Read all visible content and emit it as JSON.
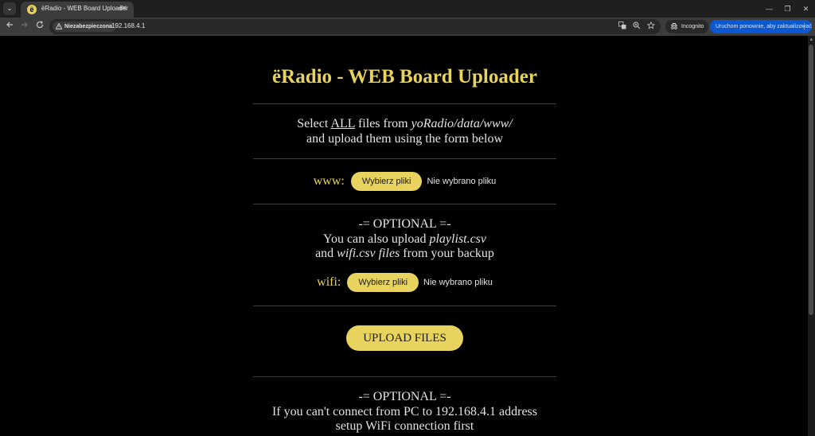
{
  "browser": {
    "tab_title": "ëRadio - WEB Board Uploader",
    "tab_favicon": "ë",
    "tab_close": "✕",
    "new_tab": "+",
    "tab_search": "⌄",
    "window_minimize": "—",
    "window_restore": "❐",
    "window_close": "✕",
    "security_label": "Niezabezpieczona",
    "url": "192.168.4.1",
    "incognito_label": "Incognito",
    "update_label": "Uruchom ponownie, aby zaktualizować",
    "update_menu": "⋮"
  },
  "page": {
    "title": "ëRadio - WEB Board Uploader",
    "intro": {
      "select": "Select ",
      "all": "ALL",
      "files_from": " files from ",
      "path": "yoRadio/data/www/",
      "line2": "and upload them using the form below"
    },
    "www_field": {
      "label": "www:",
      "button": "Wybierz pliki",
      "status": "Nie wybrano pliku"
    },
    "optional": {
      "header": "-= OPTIONAL =-",
      "line1_prefix": "You can also upload ",
      "line1_file": "playlist.csv",
      "line2_prefix": "and ",
      "line2_file": "wifi.csv files",
      "line2_suffix": " from your backup"
    },
    "wifi_field": {
      "label": "wifi:",
      "button": "Wybierz pliki",
      "status": "Nie wybrano pliku"
    },
    "upload_button": "UPLOAD FILES",
    "optional2": {
      "header": "-= OPTIONAL =-",
      "line1": "If you can't connect from PC to 192.168.4.1 address",
      "line2": "setup WiFi connection first"
    }
  },
  "colors": {
    "accent": "#e8d35e",
    "background": "#000000",
    "text": "#e3e3e3",
    "update_button": "#0b57d0"
  },
  "icons": {
    "back": "arrow-left-icon",
    "forward": "arrow-right-icon",
    "reload": "reload-icon",
    "warning": "warning-icon",
    "translate": "translate-icon",
    "zoom": "zoom-icon",
    "bookmark": "star-icon",
    "incognito": "incognito-icon"
  }
}
